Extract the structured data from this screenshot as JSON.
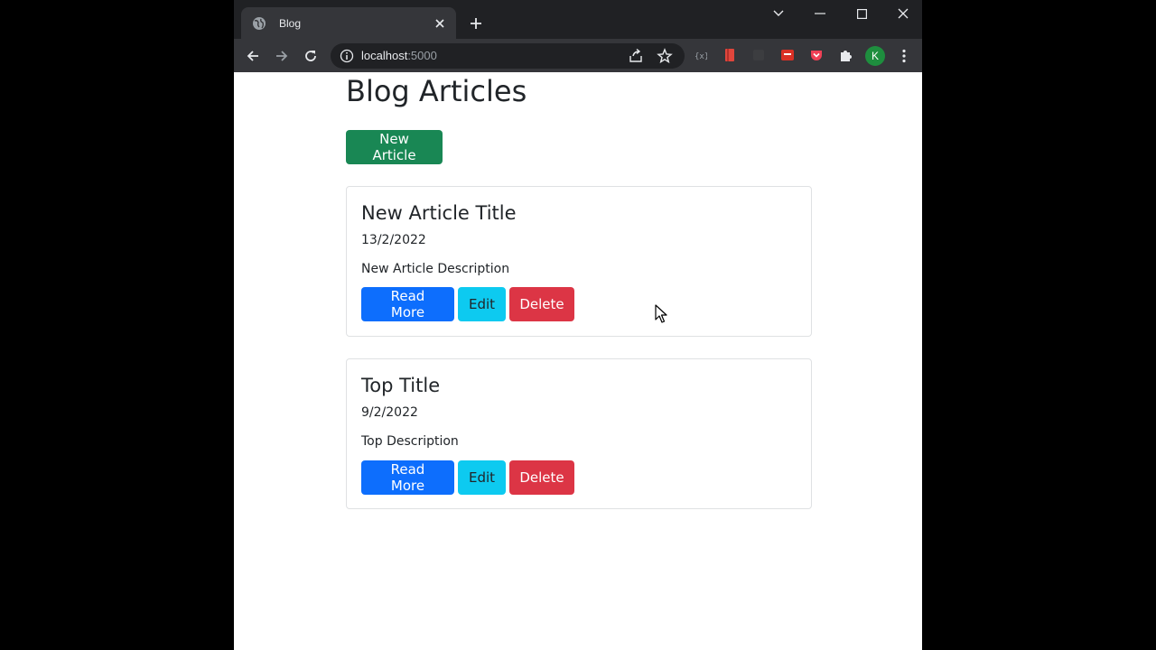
{
  "browser": {
    "tab": {
      "title": "Blog"
    },
    "url": {
      "host": "localhost",
      "port": ":5000"
    },
    "profile_initial": "K"
  },
  "page": {
    "heading": "Blog Articles",
    "new_article_label": "New Article",
    "articles": [
      {
        "title": "New Article Title",
        "date": "13/2/2022",
        "description": "New Article Description",
        "read_more_label": "Read More",
        "edit_label": "Edit",
        "delete_label": "Delete"
      },
      {
        "title": "Top Title",
        "date": "9/2/2022",
        "description": "Top Description",
        "read_more_label": "Read More",
        "edit_label": "Edit",
        "delete_label": "Delete"
      }
    ]
  },
  "icons": {
    "tab_favicon": "globe-icon",
    "tab_close": "close-icon",
    "new_tab": "plus-icon",
    "back": "arrow-left-icon",
    "forward": "arrow-right-icon",
    "reload": "reload-icon",
    "site_info": "info-icon",
    "share": "share-icon",
    "bookmark": "star-icon",
    "extensions": "puzzle-icon",
    "menu": "kebab-menu-icon"
  },
  "colors": {
    "success": "#198754",
    "primary": "#0d6efd",
    "info": "#0dcaf0",
    "danger": "#dc3545",
    "chrome_dark": "#202124",
    "chrome_tab": "#35363a"
  }
}
